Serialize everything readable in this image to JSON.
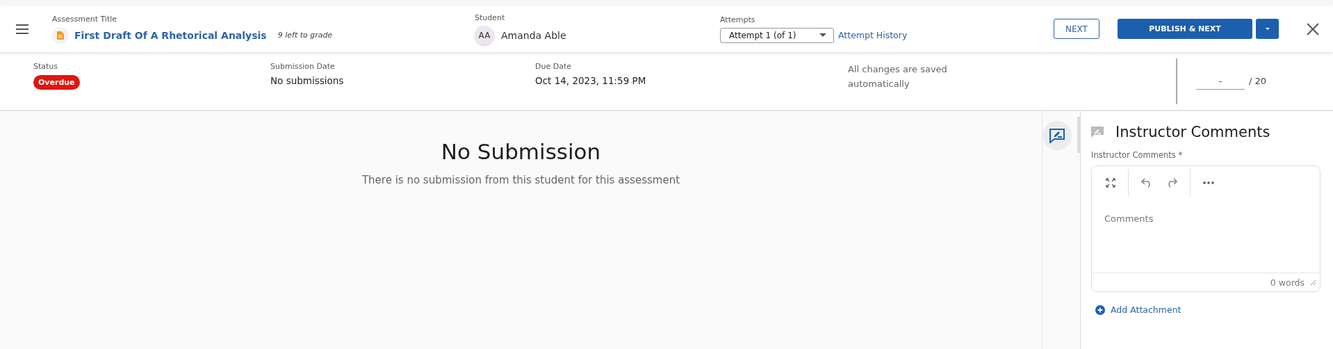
{
  "header": {
    "assessment_label": "Assessment Title",
    "assessment_title": "First Draft Of A Rhetorical Analysis",
    "left_to_grade": "9 left to grade",
    "student_label": "Student",
    "student_initials": "AA",
    "student_name": "Amanda Able",
    "attempts_label": "Attempts",
    "attempt_value": "Attempt 1 (of 1)",
    "attempt_history": "Attempt History",
    "next_button": "NEXT",
    "publish_button": "PUBLISH & NEXT"
  },
  "info": {
    "status_label": "Status",
    "status": "Overdue",
    "submission_label": "Submission Date",
    "submission_value": "No submissions",
    "due_label": "Due Date",
    "due_value": "Oct 14, 2023, 11:59 PM",
    "save_note": "All changes are saved automatically",
    "score_value": "-",
    "score_max": "/ 20"
  },
  "main": {
    "heading": "No Submission",
    "message": "There is no submission from this student for this assessment"
  },
  "comments": {
    "heading": "Instructor Comments",
    "field_label": "Instructor Comments *",
    "placeholder": "Comments",
    "word_count": "0 words",
    "add_attachment": "Add Attachment"
  }
}
